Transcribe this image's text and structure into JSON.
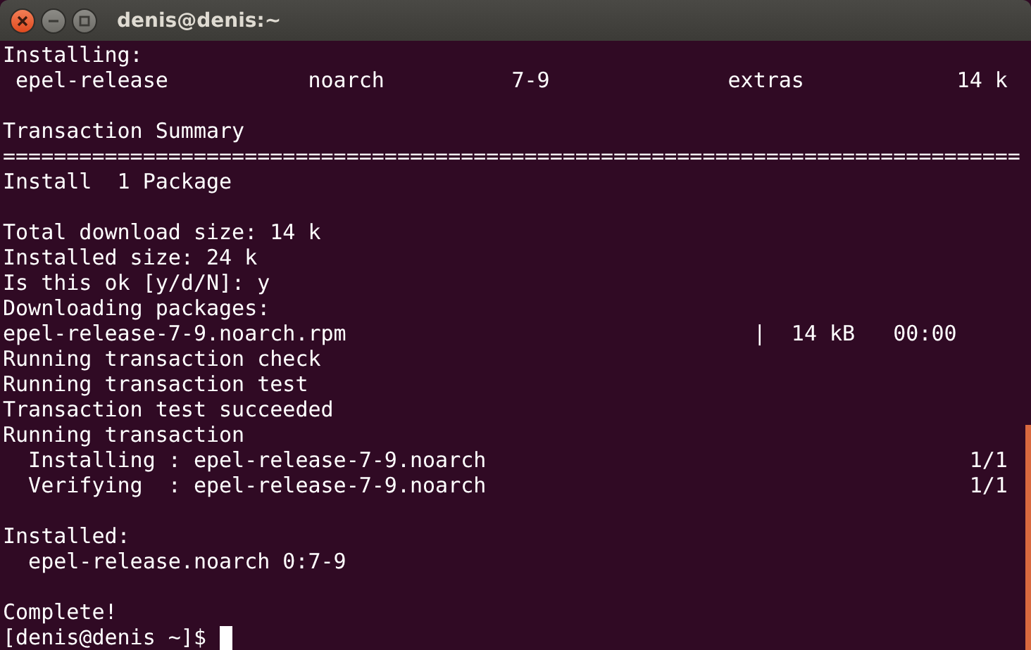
{
  "window": {
    "title": "denis@denis:~"
  },
  "terminal": {
    "blocks": [
      [
        "Installing:",
        " epel-release           noarch          7-9              extras            14 k"
      ],
      [
        "Transaction Summary",
        "================================================================================",
        "Install  1 Package"
      ],
      [
        "Total download size: 14 k",
        "Installed size: 24 k",
        "Is this ok [y/d/N]: y",
        "Downloading packages:",
        "epel-release-7-9.noarch.rpm                                |  14 kB   00:00",
        "Running transaction check",
        "Running transaction test",
        "Transaction test succeeded",
        "Running transaction",
        "  Installing : epel-release-7-9.noarch                                      1/1",
        "  Verifying  : epel-release-7-9.noarch                                      1/1"
      ],
      [
        "Installed:",
        "  epel-release.noarch 0:7-9"
      ],
      [
        "Complete!"
      ]
    ],
    "prompt": "[denis@denis ~]$"
  }
}
